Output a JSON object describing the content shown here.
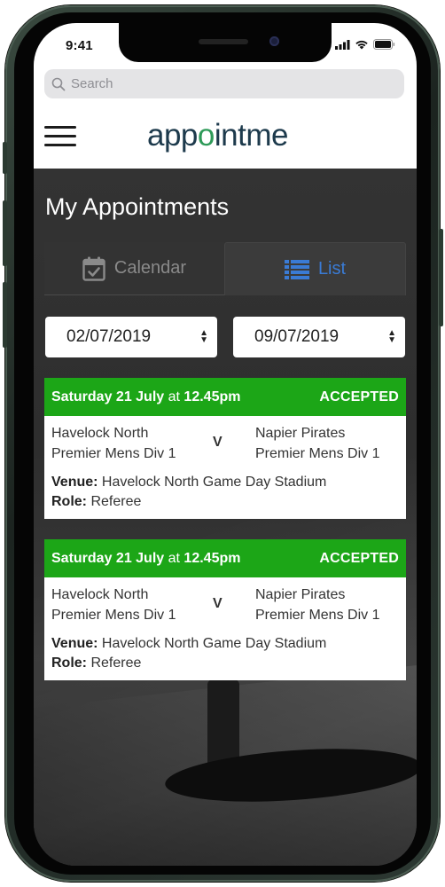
{
  "status_bar": {
    "time": "9:41"
  },
  "search": {
    "placeholder": "Search"
  },
  "header": {
    "logo_left": "app",
    "logo_mid": "o",
    "logo_right": "intme"
  },
  "page_title": "My Appointments",
  "tabs": [
    {
      "label": "Calendar",
      "icon": "calendar-icon",
      "active": false
    },
    {
      "label": "List",
      "icon": "list-icon",
      "active": true
    }
  ],
  "date_range": {
    "from": "02/07/2019",
    "to": "09/07/2019"
  },
  "colors": {
    "accepted": "#1ca617",
    "active_tab": "#3a7bd5",
    "logo_dark": "#1d3a4c",
    "logo_green": "#2e9a58"
  },
  "appointments": [
    {
      "day": "Saturday 21 July",
      "at": "at",
      "time": "12.45pm",
      "status": "ACCEPTED",
      "home_team": "Havelock North",
      "home_div": "Premier Mens Div 1",
      "vs": "V",
      "away_team": "Napier Pirates",
      "away_div": "Premier Mens Div 1",
      "venue_label": "Venue:",
      "venue": "Havelock North Game Day Stadium",
      "role_label": "Role:",
      "role": "Referee"
    },
    {
      "day": "Saturday 21 July",
      "at": "at",
      "time": "12.45pm",
      "status": "ACCEPTED",
      "home_team": "Havelock North",
      "home_div": "Premier Mens Div 1",
      "vs": "V",
      "away_team": "Napier Pirates",
      "away_div": "Premier Mens Div 1",
      "venue_label": "Venue:",
      "venue": "Havelock North Game Day Stadium",
      "role_label": "Role:",
      "role": "Referee"
    }
  ]
}
